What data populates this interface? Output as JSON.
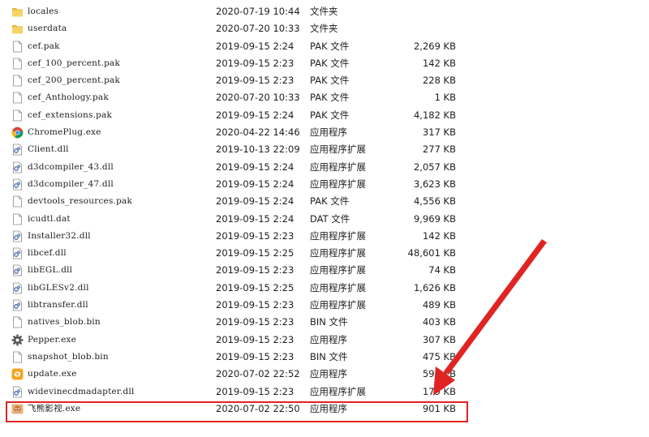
{
  "files": [
    {
      "name": "locales",
      "date": "2020-07-19 10:44",
      "type": "文件夹",
      "size": "",
      "icon": "folder-icon"
    },
    {
      "name": "userdata",
      "date": "2020-07-20 10:33",
      "type": "文件夹",
      "size": "",
      "icon": "folder-icon"
    },
    {
      "name": "cef.pak",
      "date": "2019-09-15 2:24",
      "type": "PAK 文件",
      "size": "2,269 KB",
      "icon": "file-icon"
    },
    {
      "name": "cef_100_percent.pak",
      "date": "2019-09-15 2:23",
      "type": "PAK 文件",
      "size": "142 KB",
      "icon": "file-icon"
    },
    {
      "name": "cef_200_percent.pak",
      "date": "2019-09-15 2:23",
      "type": "PAK 文件",
      "size": "228 KB",
      "icon": "file-icon"
    },
    {
      "name": "cef_Anthology.pak",
      "date": "2020-07-20 10:33",
      "type": "PAK 文件",
      "size": "1 KB",
      "icon": "file-icon"
    },
    {
      "name": "cef_extensions.pak",
      "date": "2019-09-15 2:24",
      "type": "PAK 文件",
      "size": "4,182 KB",
      "icon": "file-icon"
    },
    {
      "name": "ChromePlug.exe",
      "date": "2020-04-22 14:46",
      "type": "应用程序",
      "size": "317 KB",
      "icon": "chrome-icon"
    },
    {
      "name": "Client.dll",
      "date": "2019-10-13 22:09",
      "type": "应用程序扩展",
      "size": "277 KB",
      "icon": "dll-icon"
    },
    {
      "name": "d3dcompiler_43.dll",
      "date": "2019-09-15 2:24",
      "type": "应用程序扩展",
      "size": "2,057 KB",
      "icon": "dll-icon"
    },
    {
      "name": "d3dcompiler_47.dll",
      "date": "2019-09-15 2:24",
      "type": "应用程序扩展",
      "size": "3,623 KB",
      "icon": "dll-icon"
    },
    {
      "name": "devtools_resources.pak",
      "date": "2019-09-15 2:24",
      "type": "PAK 文件",
      "size": "4,556 KB",
      "icon": "file-icon"
    },
    {
      "name": "icudtl.dat",
      "date": "2019-09-15 2:24",
      "type": "DAT 文件",
      "size": "9,969 KB",
      "icon": "file-icon"
    },
    {
      "name": "Installer32.dll",
      "date": "2019-09-15 2:23",
      "type": "应用程序扩展",
      "size": "142 KB",
      "icon": "dll-icon"
    },
    {
      "name": "libcef.dll",
      "date": "2019-09-15 2:25",
      "type": "应用程序扩展",
      "size": "48,601 KB",
      "icon": "dll-icon"
    },
    {
      "name": "libEGL.dll",
      "date": "2019-09-15 2:23",
      "type": "应用程序扩展",
      "size": "74 KB",
      "icon": "dll-icon"
    },
    {
      "name": "libGLESv2.dll",
      "date": "2019-09-15 2:25",
      "type": "应用程序扩展",
      "size": "1,626 KB",
      "icon": "dll-icon"
    },
    {
      "name": "libtransfer.dll",
      "date": "2019-09-15 2:23",
      "type": "应用程序扩展",
      "size": "489 KB",
      "icon": "dll-icon"
    },
    {
      "name": "natives_blob.bin",
      "date": "2019-09-15 2:23",
      "type": "BIN 文件",
      "size": "403 KB",
      "icon": "file-icon"
    },
    {
      "name": "Pepper.exe",
      "date": "2019-09-15 2:23",
      "type": "应用程序",
      "size": "307 KB",
      "icon": "gear-icon"
    },
    {
      "name": "snapshot_blob.bin",
      "date": "2019-09-15 2:23",
      "type": "BIN 文件",
      "size": "475 KB",
      "icon": "file-icon"
    },
    {
      "name": "update.exe",
      "date": "2020-07-02 22:52",
      "type": "应用程序",
      "size": "599 KB",
      "icon": "update-icon"
    },
    {
      "name": "widevinecdmadapter.dll",
      "date": "2019-09-15 2:23",
      "type": "应用程序扩展",
      "size": "179 KB",
      "icon": "dll-icon"
    },
    {
      "name": "飞熊影视.exe",
      "date": "2020-07-02 22:50",
      "type": "应用程序",
      "size": "901 KB",
      "icon": "app-icon"
    }
  ],
  "colors": {
    "highlight": "#e02424",
    "arrow": "#e02424",
    "folder": "#f2c94c"
  }
}
